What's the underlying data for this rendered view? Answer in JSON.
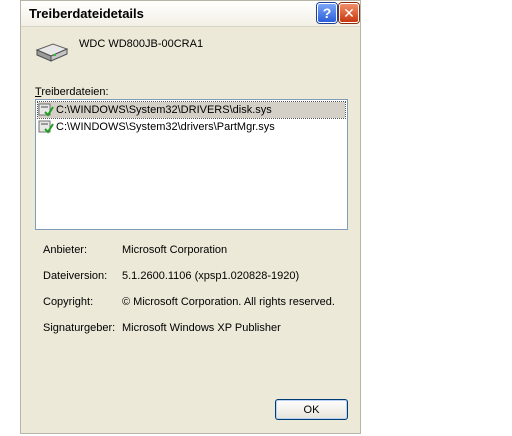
{
  "dialog": {
    "title": "Treiberdateidetails",
    "help_button": "?",
    "close_button": "✕",
    "device_name": "WDC WD800JB-00CRA1",
    "files_label_prefix": "T",
    "files_label_rest": "reiberdateien:",
    "files": [
      {
        "path": "C:\\WINDOWS\\System32\\DRIVERS\\disk.sys",
        "selected": true
      },
      {
        "path": "C:\\WINDOWS\\System32\\drivers\\PartMgr.sys",
        "selected": false
      }
    ],
    "properties": [
      {
        "label": "Anbieter:",
        "value": "Microsoft Corporation"
      },
      {
        "label": "Dateiversion:",
        "value": "5.1.2600.1106 (xpsp1.020828-1920)"
      },
      {
        "label": "Copyright:",
        "value": "© Microsoft Corporation. All rights reserved."
      },
      {
        "label": "Signaturgeber:",
        "value": "Microsoft Windows XP Publisher"
      }
    ],
    "ok_label": "OK"
  }
}
